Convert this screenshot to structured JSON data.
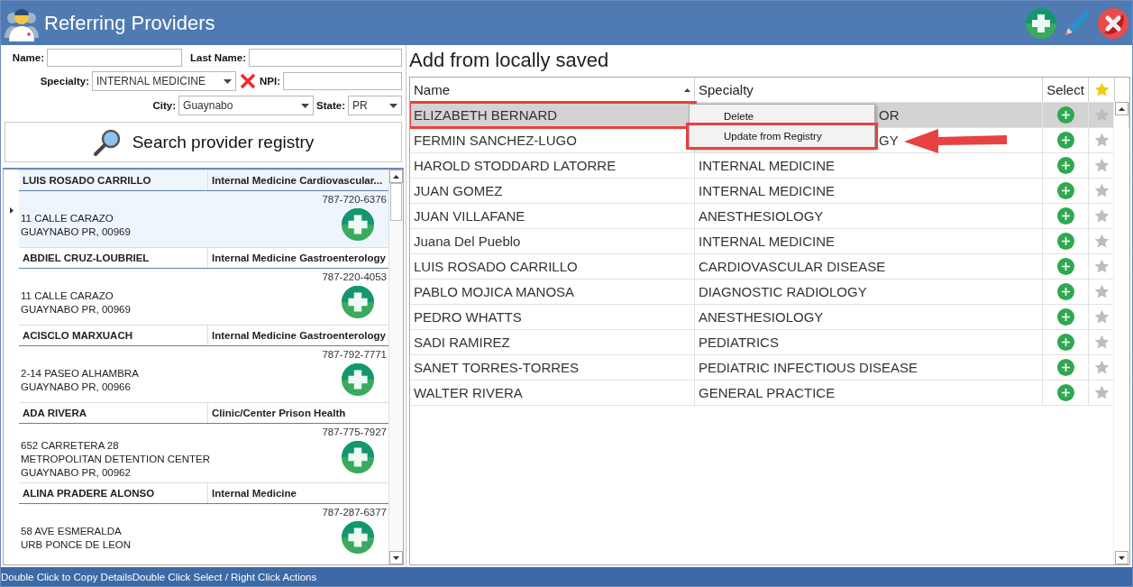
{
  "window": {
    "title": "Referring Providers"
  },
  "search_form": {
    "name_label": "Name:",
    "last_name_label": "Last Name:",
    "specialty_label": "Specialty:",
    "specialty_value": "INTERNAL MEDICINE",
    "npi_label": "NPI:",
    "city_label": "City:",
    "city_value": "Guaynabo",
    "state_label": "State:",
    "state_value": "PR",
    "search_button": "Search provider registry"
  },
  "registry_results": [
    {
      "name": "LUIS ROSADO CARRILLO",
      "specialty": "Internal Medicine Cardiovascular...",
      "phone": "787-720-6376",
      "address": [
        "11 CALLE CARAZO",
        "GUAYNABO PR, 00969"
      ],
      "selected": true
    },
    {
      "name": "ABDIEL CRUZ-LOUBRIEL",
      "specialty": "Internal Medicine Gastroenterology",
      "phone": "787-220-4053",
      "address": [
        "11 CALLE CARAZO",
        "GUAYNABO PR, 00969"
      ],
      "selected": false
    },
    {
      "name": "ACISCLO MARXUACH",
      "specialty": "Internal Medicine Gastroenterology",
      "phone": "787-792-7771",
      "address": [
        "2-14 PASEO ALHAMBRA",
        "GUAYNABO PR, 00966"
      ],
      "selected": false
    },
    {
      "name": "ADA RIVERA",
      "specialty": "Clinic/Center Prison Health",
      "phone": "787-775-7927",
      "address": [
        "652 CARRETERA 28",
        "METROPOLITAN DETENTION CENTER",
        "GUAYNABO PR, 00962"
      ],
      "selected": false
    },
    {
      "name": "ALINA PRADERE ALONSO",
      "specialty": "Internal Medicine",
      "phone": "787-287-6377",
      "address": [
        "58 AVE ESMERALDA",
        "URB PONCE DE LEON"
      ],
      "selected": false
    }
  ],
  "saved": {
    "title": "Add from locally saved",
    "columns": [
      "Name",
      "Specialty",
      "Select"
    ],
    "rows": [
      {
        "name": "ELIZABETH BERNARD",
        "specialty": "OR",
        "selected": true,
        "covered": true,
        "callout": true,
        "favorite": false
      },
      {
        "name": "FERMIN SANCHEZ-LUGO",
        "specialty": "GY",
        "selected": false,
        "covered": true,
        "callout": false,
        "favorite": false
      },
      {
        "name": "HAROLD STODDARD LATORRE",
        "specialty": "INTERNAL MEDICINE",
        "selected": false,
        "covered": false,
        "callout": false,
        "favorite": false
      },
      {
        "name": "JUAN GOMEZ",
        "specialty": "INTERNAL MEDICINE",
        "selected": false,
        "covered": false,
        "callout": false,
        "favorite": false
      },
      {
        "name": "JUAN VILLAFANE",
        "specialty": "ANESTHESIOLOGY",
        "selected": false,
        "covered": false,
        "callout": false,
        "favorite": false
      },
      {
        "name": "Juana  Del Pueblo",
        "specialty": "INTERNAL MEDICINE",
        "selected": false,
        "covered": false,
        "callout": false,
        "favorite": false
      },
      {
        "name": "LUIS ROSADO CARRILLO",
        "specialty": "CARDIOVASCULAR DISEASE",
        "selected": false,
        "covered": false,
        "callout": false,
        "favorite": false
      },
      {
        "name": "PABLO MOJICA MANOSA",
        "specialty": "DIAGNOSTIC RADIOLOGY",
        "selected": false,
        "covered": false,
        "callout": false,
        "favorite": false
      },
      {
        "name": "PEDRO WHATTS",
        "specialty": "ANESTHESIOLOGY",
        "selected": false,
        "covered": false,
        "callout": false,
        "favorite": false
      },
      {
        "name": "SADI RAMIREZ",
        "specialty": "PEDIATRICS",
        "selected": false,
        "covered": false,
        "callout": false,
        "favorite": false
      },
      {
        "name": "SANET TORRES-TORRES",
        "specialty": "PEDIATRIC INFECTIOUS DISEASE",
        "selected": false,
        "covered": false,
        "callout": false,
        "favorite": false
      },
      {
        "name": "WALTER RIVERA",
        "specialty": "GENERAL PRACTICE",
        "selected": false,
        "covered": false,
        "callout": false,
        "favorite": false
      }
    ],
    "context_menu": [
      {
        "label": "Delete",
        "callout": false
      },
      {
        "label": "Update from Registry",
        "callout": true
      }
    ]
  },
  "status_bar": [
    "Double Click to Copy Details",
    "Double Click Select / Right Click Actions"
  ]
}
